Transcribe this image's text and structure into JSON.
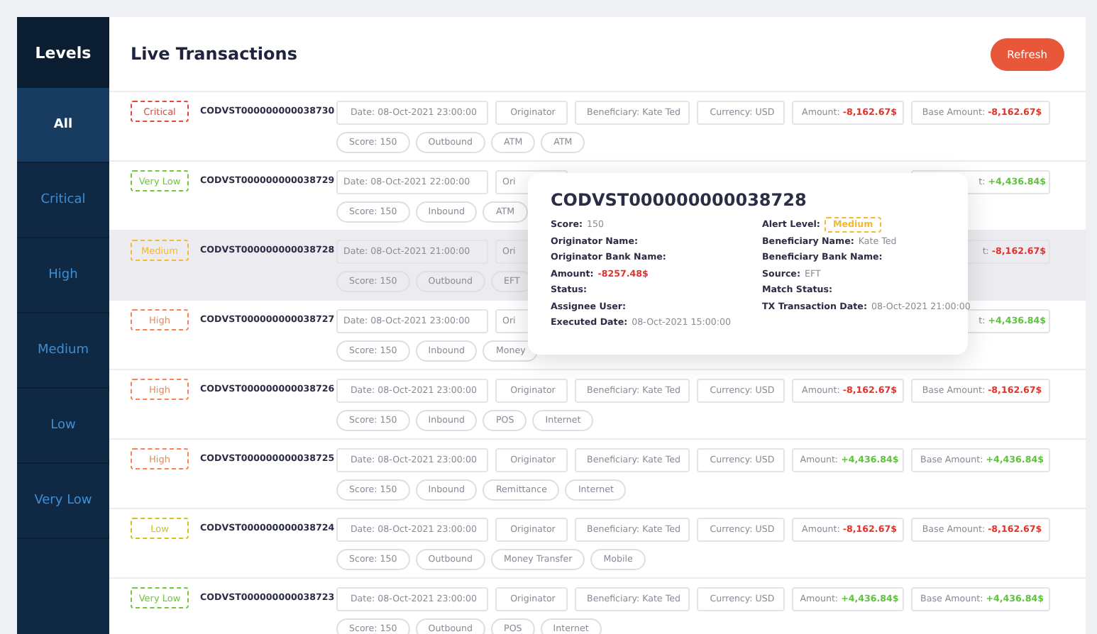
{
  "sidebar": {
    "title": "Levels",
    "items": [
      {
        "label": "All",
        "selected": true
      },
      {
        "label": "Critical",
        "selected": false
      },
      {
        "label": "High",
        "selected": false
      },
      {
        "label": "Medium",
        "selected": false
      },
      {
        "label": "Low",
        "selected": false
      },
      {
        "label": "Very Low",
        "selected": false
      }
    ]
  },
  "header": {
    "title": "Live Transactions",
    "refresh_button": "Refresh"
  },
  "rows": [
    {
      "level": {
        "label": "Critical",
        "color": "#e5483b"
      },
      "code": "CODVST000000000038730",
      "highlighted": false,
      "fields": [
        {
          "kind": "date",
          "label": "Date: 08-Oct-2021 23:00:00"
        },
        {
          "kind": "originator",
          "label": "Originator"
        },
        {
          "kind": "beneficiary",
          "label": "Beneficiary: Kate Ted"
        },
        {
          "kind": "currency",
          "label": "Currency: USD"
        },
        {
          "kind": "amount",
          "label": "Amount:",
          "value": "-8,162.67$",
          "negative": true
        },
        {
          "kind": "base",
          "label": "Base Amount:",
          "value": "-8,162.67$",
          "negative": true
        }
      ],
      "tags": [
        "Score: 150",
        "Outbound",
        "ATM",
        "ATM"
      ]
    },
    {
      "level": {
        "label": "Very Low",
        "color": "#6cc93a"
      },
      "code": "CODVST000000000038729",
      "highlighted": false,
      "fields": [
        {
          "kind": "date",
          "label": "Date: 08-Oct-2021 22:00:00"
        },
        {
          "kind": "originator",
          "label": "Ori"
        },
        {
          "kind": "base",
          "label": "t:",
          "value": "+4,436.84$",
          "negative": false
        }
      ],
      "tags": [
        "Score: 150",
        "Inbound",
        "ATM"
      ]
    },
    {
      "level": {
        "label": "Medium",
        "color": "#f5b82e"
      },
      "code": "CODVST000000000038728",
      "highlighted": true,
      "fields": [
        {
          "kind": "date",
          "label": "Date: 08-Oct-2021 21:00:00"
        },
        {
          "kind": "originator",
          "label": "Ori"
        },
        {
          "kind": "base",
          "label": "t:",
          "value": "-8,162.67$",
          "negative": true
        }
      ],
      "tags": [
        "Score: 150",
        "Outbound",
        "EFT"
      ]
    },
    {
      "level": {
        "label": "High",
        "color": "#f7844f"
      },
      "code": "CODVST000000000038727",
      "highlighted": false,
      "fields": [
        {
          "kind": "date",
          "label": "Date: 08-Oct-2021 23:00:00"
        },
        {
          "kind": "originator",
          "label": "Ori"
        },
        {
          "kind": "base",
          "label": "t:",
          "value": "+4,436.84$",
          "negative": false
        }
      ],
      "tags": [
        "Score: 150",
        "Inbound",
        "Money"
      ]
    },
    {
      "level": {
        "label": "High",
        "color": "#f7844f"
      },
      "code": "CODVST000000000038726",
      "highlighted": false,
      "fields": [
        {
          "kind": "date",
          "label": "Date: 08-Oct-2021 23:00:00"
        },
        {
          "kind": "originator",
          "label": "Originator"
        },
        {
          "kind": "beneficiary",
          "label": "Beneficiary: Kate Ted"
        },
        {
          "kind": "currency",
          "label": "Currency: USD"
        },
        {
          "kind": "amount",
          "label": "Amount:",
          "value": "-8,162.67$",
          "negative": true
        },
        {
          "kind": "base",
          "label": "Base Amount:",
          "value": "-8,162.67$",
          "negative": true
        }
      ],
      "tags": [
        "Score: 150",
        "Inbound",
        "POS",
        "Internet"
      ]
    },
    {
      "level": {
        "label": "High",
        "color": "#f7844f"
      },
      "code": "CODVST000000000038725",
      "highlighted": false,
      "fields": [
        {
          "kind": "date",
          "label": "Date: 08-Oct-2021 23:00:00"
        },
        {
          "kind": "originator",
          "label": "Originator"
        },
        {
          "kind": "beneficiary",
          "label": "Beneficiary: Kate Ted"
        },
        {
          "kind": "currency",
          "label": "Currency: USD"
        },
        {
          "kind": "amount",
          "label": "Amount:",
          "value": "+4,436.84$",
          "negative": false
        },
        {
          "kind": "base",
          "label": "Base Amount:",
          "value": "+4,436.84$",
          "negative": false
        }
      ],
      "tags": [
        "Score: 150",
        "Inbound",
        "Remittance",
        "Internet"
      ]
    },
    {
      "level": {
        "label": "Low",
        "color": "#d4c21c"
      },
      "code": "CODVST000000000038724",
      "highlighted": false,
      "fields": [
        {
          "kind": "date",
          "label": "Date: 08-Oct-2021 23:00:00"
        },
        {
          "kind": "originator",
          "label": "Originator"
        },
        {
          "kind": "beneficiary",
          "label": "Beneficiary: Kate Ted"
        },
        {
          "kind": "currency",
          "label": "Currency: USD"
        },
        {
          "kind": "amount",
          "label": "Amount:",
          "value": "-8,162.67$",
          "negative": true
        },
        {
          "kind": "base",
          "label": "Base Amount:",
          "value": "-8,162.67$",
          "negative": true
        }
      ],
      "tags": [
        "Score: 150",
        "Outbound",
        "Money Transfer",
        "Mobile"
      ]
    },
    {
      "level": {
        "label": "Very Low",
        "color": "#6cc93a"
      },
      "code": "CODVST000000000038723",
      "highlighted": false,
      "fields": [
        {
          "kind": "date",
          "label": "Date: 08-Oct-2021 23:00:00"
        },
        {
          "kind": "originator",
          "label": "Originator"
        },
        {
          "kind": "beneficiary",
          "label": "Beneficiary: Kate Ted"
        },
        {
          "kind": "currency",
          "label": "Currency: USD"
        },
        {
          "kind": "amount",
          "label": "Amount:",
          "value": "+4,436.84$",
          "negative": false
        },
        {
          "kind": "base",
          "label": "Base Amount:",
          "value": "+4,436.84$",
          "negative": false
        }
      ],
      "tags": [
        "Score: 150",
        "Outbound",
        "POS",
        "Internet"
      ]
    }
  ],
  "tooltip": {
    "title": "CODVST000000000038728",
    "left": [
      {
        "kind": "text",
        "label": "Score:",
        "value": "150"
      },
      {
        "kind": "text",
        "label": "Originator Name:"
      },
      {
        "kind": "text",
        "label": "Originator Bank Name:"
      },
      {
        "kind": "text",
        "label": "Amount:",
        "value": "-8257.48$",
        "negative": true
      },
      {
        "kind": "text",
        "label": "Status:"
      },
      {
        "kind": "text",
        "label": "Assignee User:"
      },
      {
        "kind": "text",
        "label": "Executed Date:",
        "value": "08-Oct-2021 15:00:00"
      }
    ],
    "right": [
      {
        "kind": "badge",
        "label": "Alert Level:",
        "value": "Medium",
        "color": "#f5b82e"
      },
      {
        "kind": "text",
        "label": "Beneficiary Name:",
        "value": "Kate Ted"
      },
      {
        "kind": "text",
        "label": "Beneficiary Bank Name:"
      },
      {
        "kind": "text",
        "label": "Source:",
        "value": "EFT"
      },
      {
        "kind": "text",
        "label": "Match Status:"
      },
      {
        "kind": "text",
        "label": "TX Transaction Date:",
        "value": "08-Oct-2021 21:00:00"
      }
    ]
  }
}
